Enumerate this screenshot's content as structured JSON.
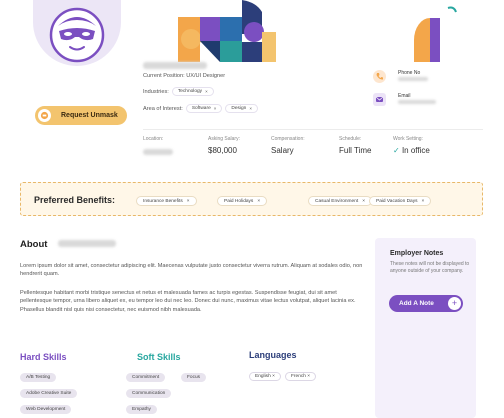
{
  "profile": {
    "position_label": "Current Position:",
    "position_value": "UX/UI Designer",
    "industries_label": "Industries:",
    "industries": [
      "Technology"
    ],
    "interest_label": "Area of Interest:",
    "interests": [
      "Software",
      "Design"
    ],
    "unmask_label": "Request Unmask"
  },
  "contact": {
    "phone_label": "Phone No",
    "email_label": "Email"
  },
  "stats": [
    {
      "key": "Location:",
      "value": ""
    },
    {
      "key": "Asking Salary:",
      "value": "$80,000"
    },
    {
      "key": "Compensation:",
      "value": "Salary"
    },
    {
      "key": "Schedule:",
      "value": "Full Time"
    },
    {
      "key": "Work Setting:",
      "value": "In office"
    }
  ],
  "benefits": {
    "title": "Preferred Benefits:",
    "items": [
      "Insurance Benefits",
      "Paid Holidays",
      "Casual Environment",
      "Paid Vacation Days"
    ]
  },
  "about": {
    "heading": "About",
    "para1": "Lorem ipsum dolor sit amet, consectetur adipiscing elit. Maecenas vulputate justo consectetur viverra rutrum. Aliquam at sodales odio, non hendrerit quam.",
    "para2": "Pellentesque habitant morbi tristique senectus et netus et malesuada fames ac turpis egestas. Suspendisse feugiat, dui sit amet pellentesque tempor, urna libero aliquet ex, eu tempor leo dui nec leo. Donec dui nunc, maximus vitae lectus volutpat, aliquet lacinia ex. Phasellus blandit nisl quis nisi consectetur, nec euismod nibh malesuada."
  },
  "notes": {
    "heading": "Employer Notes",
    "description": "These notes will not be displayed to anyone outside of your company.",
    "add_label": "Add A Note"
  },
  "skills": {
    "hard_heading": "Hard Skills",
    "hard": [
      "A/B Testing",
      "Adobe Creative Suite",
      "Web Development"
    ],
    "soft_heading": "Soft Skills",
    "soft": [
      "Commitment",
      "Focus",
      "Communication",
      "Empathy"
    ],
    "lang_heading": "Languages",
    "languages": [
      "English",
      "French"
    ]
  },
  "colors": {
    "accent": "#7b4fc1",
    "orange": "#f3a64a",
    "hard_skills": "#7b4fc1",
    "soft_skills": "#28a7a0",
    "languages": "#2c3e7a"
  }
}
